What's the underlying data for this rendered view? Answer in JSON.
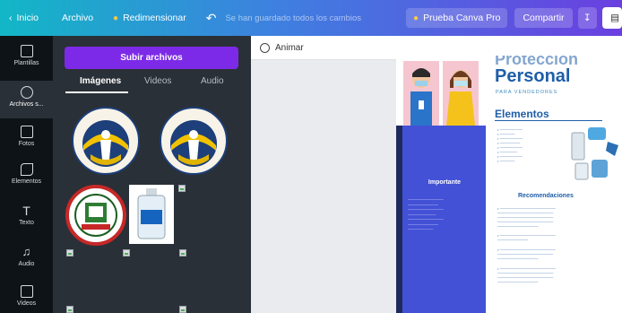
{
  "topbar": {
    "back_label": "Inicio",
    "archivo_label": "Archivo",
    "resize_label": "Redimensionar",
    "saved_text": "Se han guardado todos los cambios",
    "pro_label": "Prueba Canva Pro",
    "share_label": "Compartir"
  },
  "rail": {
    "items": [
      {
        "label": "Plantillas",
        "icon": "templates-icon"
      },
      {
        "label": "Archivos s...",
        "icon": "uploads-icon"
      },
      {
        "label": "Fotos",
        "icon": "photos-icon"
      },
      {
        "label": "Elementos",
        "icon": "elements-icon"
      },
      {
        "label": "Texto",
        "icon": "text-icon"
      },
      {
        "label": "Audio",
        "icon": "audio-icon"
      },
      {
        "label": "Videos",
        "icon": "videos-icon"
      }
    ]
  },
  "panel": {
    "upload_label": "Subir archivos",
    "tabs": [
      "Imágenes",
      "Videos",
      "Audio"
    ]
  },
  "canvas": {
    "animate_label": "Animar"
  },
  "design": {
    "title_main": "Personal",
    "title_top": "Protección",
    "subtitle": "PARA VENDEDORES",
    "elementos": "Elementos",
    "importante": "Importante",
    "recomendaciones": "Recomendaciones"
  },
  "colors": {
    "upload": "#7d2ae8",
    "design_blue": "#4351d6",
    "title_blue": "#1f5ea8"
  }
}
